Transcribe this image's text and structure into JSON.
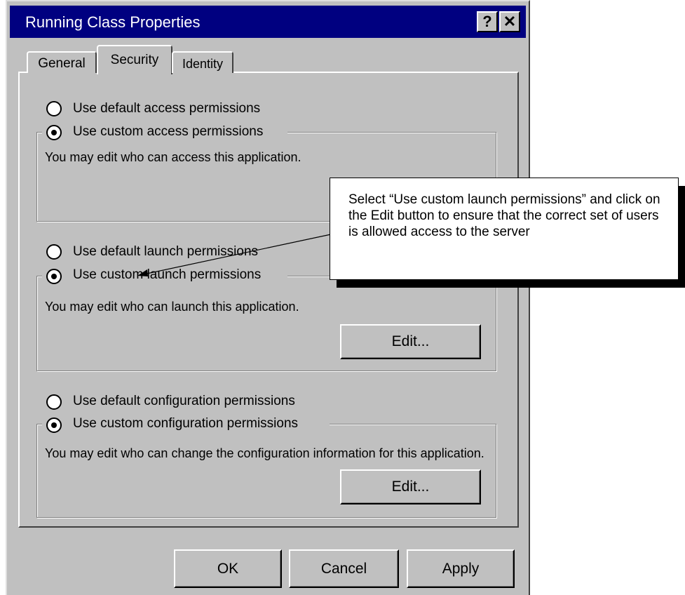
{
  "window": {
    "title": "Running Class Properties",
    "help_label": "?",
    "close_label": "✕"
  },
  "tabs": [
    {
      "label": "General",
      "active": false
    },
    {
      "label": "Security",
      "active": true
    },
    {
      "label": "Identity",
      "active": false
    }
  ],
  "access": {
    "default_label": "Use default access permissions",
    "custom_label": "Use custom access permissions",
    "description": "You may edit who can access this application."
  },
  "launch": {
    "default_label": "Use default launch permissions",
    "custom_label": "Use custom launch permissions",
    "description": "You may edit who can launch this application.",
    "edit_label": "Edit..."
  },
  "configuration": {
    "default_label": "Use default configuration permissions",
    "custom_label": "Use custom configuration permissions",
    "description": "You may edit who can change the configuration information for this application.",
    "edit_label": "Edit..."
  },
  "footer": {
    "ok_label": "OK",
    "cancel_label": "Cancel",
    "apply_label": "Apply"
  },
  "callout": {
    "text": "Select “Use custom launch permissions” and click on the Edit button to ensure that the correct set of users is allowed access to the server"
  }
}
